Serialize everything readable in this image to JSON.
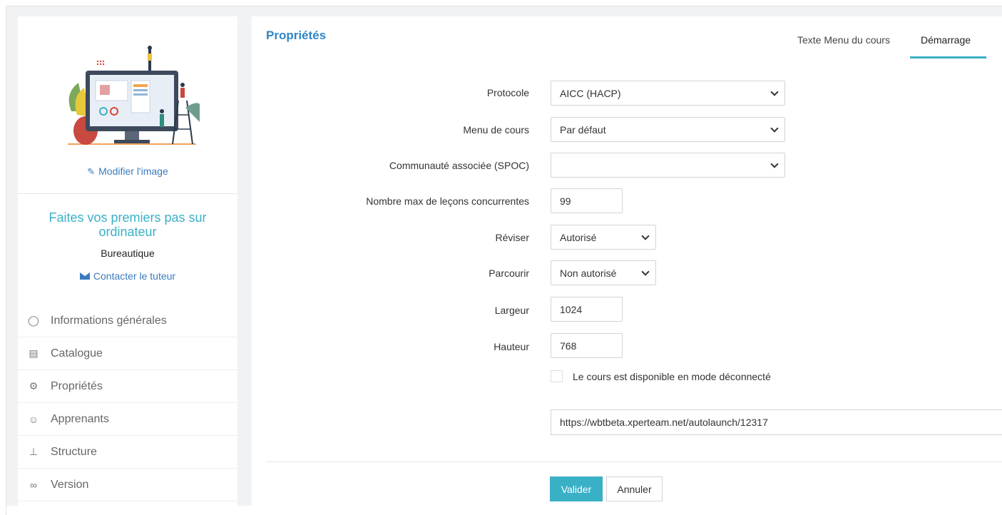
{
  "sidebar": {
    "modify_image_label": "Modifier l'image",
    "course_title": "Faites vos premiers pas sur ordinateur",
    "course_category": "Bureautique",
    "contact_label": "Contacter le tuteur",
    "nav": [
      {
        "label": "Informations générales",
        "icon": "speech-bubble-icon"
      },
      {
        "label": "Catalogue",
        "icon": "book-icon"
      },
      {
        "label": "Propriétés",
        "icon": "gear-icon"
      },
      {
        "label": "Apprenants",
        "icon": "users-icon"
      },
      {
        "label": "Structure",
        "icon": "sitemap-icon"
      },
      {
        "label": "Version",
        "icon": "link-icon"
      }
    ]
  },
  "main": {
    "title": "Propriétés",
    "tabs": [
      {
        "label": "Texte Menu du cours",
        "active": false
      },
      {
        "label": "Démarrage",
        "active": true
      }
    ],
    "fields": {
      "protocole": {
        "label": "Protocole",
        "value": "AICC (HACP)"
      },
      "menu_cours": {
        "label": "Menu de cours",
        "value": "Par défaut"
      },
      "communaute": {
        "label": "Communauté associée (SPOC)",
        "value": ""
      },
      "nombre_max": {
        "label": "Nombre max de leçons concurrentes",
        "value": "99"
      },
      "reviser": {
        "label": "Réviser",
        "value": "Autorisé"
      },
      "parcourir": {
        "label": "Parcourir",
        "value": "Non autorisé"
      },
      "largeur": {
        "label": "Largeur",
        "value": "1024"
      },
      "hauteur": {
        "label": "Hauteur",
        "value": "768"
      }
    },
    "offline_label": "Le cours est disponible en mode déconnecté",
    "offline_checked": false,
    "launch_url": "https://wbtbeta.xperteam.net/autolaunch/12317",
    "buttons": {
      "submit": "Valider",
      "cancel": "Annuler"
    }
  },
  "colors": {
    "accent": "#3ab0c6",
    "link": "#3b7bbf",
    "title": "#2f86c6",
    "background_band": "#f1f2f4"
  }
}
